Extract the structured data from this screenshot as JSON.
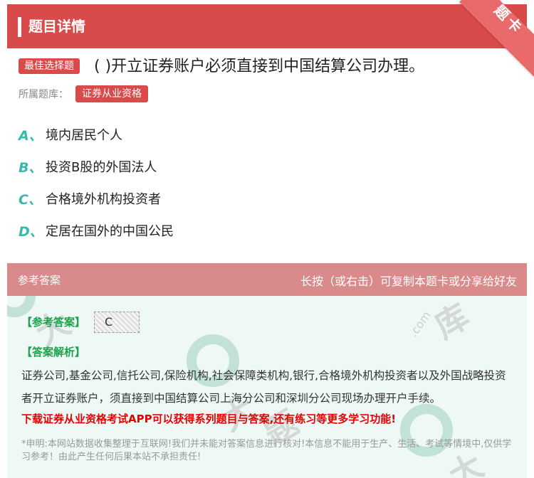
{
  "header": {
    "title": "题目详情",
    "ribbon": "题卡"
  },
  "question": {
    "type_badge": "最佳选择题",
    "text": "( )开立证券账户必须直接到中国结算公司办理。",
    "bank_label": "所属题库：",
    "bank_name": "证券从业资格"
  },
  "options": [
    {
      "letter": "A、",
      "text": "境内居民个人"
    },
    {
      "letter": "B、",
      "text": "投资B股的外国法人"
    },
    {
      "letter": "C、",
      "text": "合格境外机构投资者"
    },
    {
      "letter": "D、",
      "text": "定居在国外的中国公民"
    }
  ],
  "answer": {
    "section_title": "参考答案",
    "share_hint": "长按（或右击）可复制本题卡或分享给好友",
    "answer_label": "【参考答案】",
    "answer_value": "C",
    "analysis_label": "【答案解析】",
    "analysis_text": "证券公司,基金公司,信托公司,保险机构,社会保障类机构,银行,合格境外机构投资者以及外国战略投资者开立证券账户，须直接到中国结算公司上海分公司和深圳分公司现场办理开户手续。",
    "promo": "下载证券从业资格考试APP可以获得系列题目与答案,还有练习等更多学习功能!",
    "disclaimer": "*申明:本网站数据收集整理于互联网!我们并未能对答案信息进行核对!本信息不能用于生产、生活、考试等情境中,仅供学习参考！由此产生任何后果本站不承担责任!"
  },
  "colors": {
    "brand_red": "#d94a4a",
    "option_letter": "#39b8b0",
    "analysis_green": "#1aa34a",
    "promo_red": "#e60000"
  }
}
